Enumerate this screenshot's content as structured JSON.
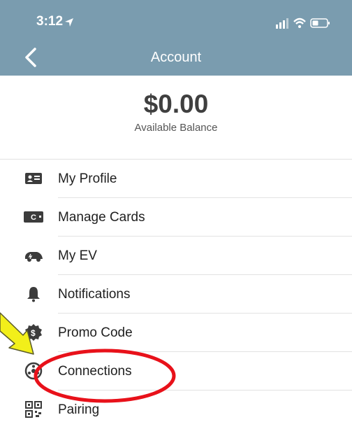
{
  "status_bar": {
    "time": "3:12"
  },
  "header": {
    "title": "Account"
  },
  "balance": {
    "amount": "$0.00",
    "label": "Available Balance"
  },
  "menu": [
    {
      "label": "My Profile",
      "icon": "id-card-icon"
    },
    {
      "label": "Manage Cards",
      "icon": "credit-card-icon"
    },
    {
      "label": "My EV",
      "icon": "car-icon"
    },
    {
      "label": "Notifications",
      "icon": "bell-icon"
    },
    {
      "label": "Promo Code",
      "icon": "dollar-badge-icon"
    },
    {
      "label": "Connections",
      "icon": "connections-icon"
    },
    {
      "label": "Pairing",
      "icon": "qr-code-icon"
    }
  ],
  "colors": {
    "header_bg": "#7a9caf",
    "annotation_circle": "#e8111a",
    "annotation_arrow": "#f2ef1a"
  }
}
